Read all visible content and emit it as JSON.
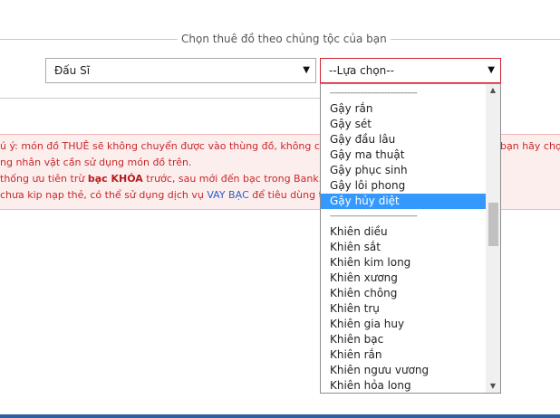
{
  "form": {
    "legend": "Chọn thuê đồ theo chủng tộc của bạn",
    "race_select": {
      "value": "Đấu Sĩ"
    },
    "item_select": {
      "value": "--Lựa chọn--"
    }
  },
  "notice": {
    "line1_left": "ú ý: món đồ THUÊ sẽ không chuyển được vào thùng đồ, không chu",
    "line1_right": "bạn hãy chọn",
    "line2": "ng nhân vật cần sử dụng món đồ trên.",
    "line3_pre": "thống ưu tiên trừ ",
    "line3_bold": "bạc KHÓA",
    "line3_post": " trước, sau mới đến bạc trong Bank.",
    "line4_pre": "chưa kip nạp thẻ, có thể sử dụng dịch vụ ",
    "line4_link": "VAY BẠC",
    "line4_post": " để tiêu dùng tr"
  },
  "dropdown": {
    "options": [
      {
        "label": "-----------------------------------"
      },
      {
        "label": "Gậy rắn"
      },
      {
        "label": "Gậy sét"
      },
      {
        "label": "Gậy đầu lâu"
      },
      {
        "label": "Gậy ma thuật"
      },
      {
        "label": "Gậy phục sinh"
      },
      {
        "label": "Gậy lôi phong"
      },
      {
        "label": "Gậy hủy diệt",
        "selected": true
      },
      {
        "label": "-----------------------------------"
      },
      {
        "label": "Khiên diều"
      },
      {
        "label": "Khiên sắt"
      },
      {
        "label": "Khiên kim long"
      },
      {
        "label": "Khiên xương"
      },
      {
        "label": "Khiên chông"
      },
      {
        "label": "Khiên trụ"
      },
      {
        "label": "Khiên gia huy"
      },
      {
        "label": "Khiên bạc"
      },
      {
        "label": "Khiên rắn"
      },
      {
        "label": "Khiên ngưu vương"
      },
      {
        "label": "Khiên hỏa long"
      }
    ]
  },
  "colors": {
    "selected_bg": "#3399ff",
    "notice_text": "#c62828",
    "accent_border": "#d02030"
  },
  "icons": {
    "dropdown_arrow": "triangle-down-icon",
    "scroll_up": "triangle-up-icon",
    "scroll_down": "triangle-down-icon"
  }
}
